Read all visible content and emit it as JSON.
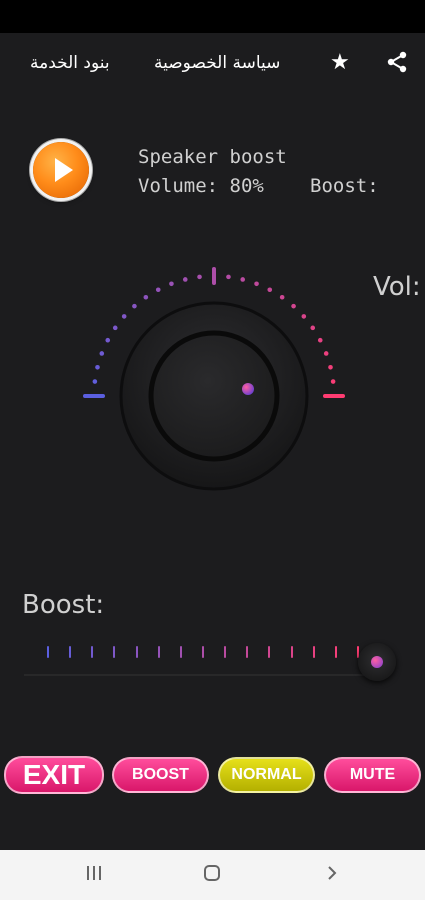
{
  "header": {
    "terms_label": "بنود الخدمة",
    "privacy_label": "سياسة الخصوصية",
    "rate_icon": "star-icon",
    "share_icon": "share-icon"
  },
  "player": {
    "title": "Speaker boost",
    "volume_text": "Volume: 80%",
    "boost_text": "Boost:",
    "play_icon": "play-icon"
  },
  "volume_knob": {
    "label": "Vol:",
    "level_percent": 80,
    "accent_start": "#5b5fe0",
    "accent_end": "#ff3c72"
  },
  "boost_slider": {
    "label": "Boost:",
    "level_fraction": 1.0
  },
  "buttons": {
    "exit": "EXIT",
    "boost": "BOOST",
    "normal": "NORMAL",
    "mute": "MUTE"
  },
  "colors": {
    "pink": "#e81f78",
    "yellow": "#c9c40c",
    "background": "#1c1c1e"
  },
  "navigation": {
    "recent_icon": "recent-apps-icon",
    "home_icon": "home-icon",
    "back_icon": "back-icon"
  }
}
